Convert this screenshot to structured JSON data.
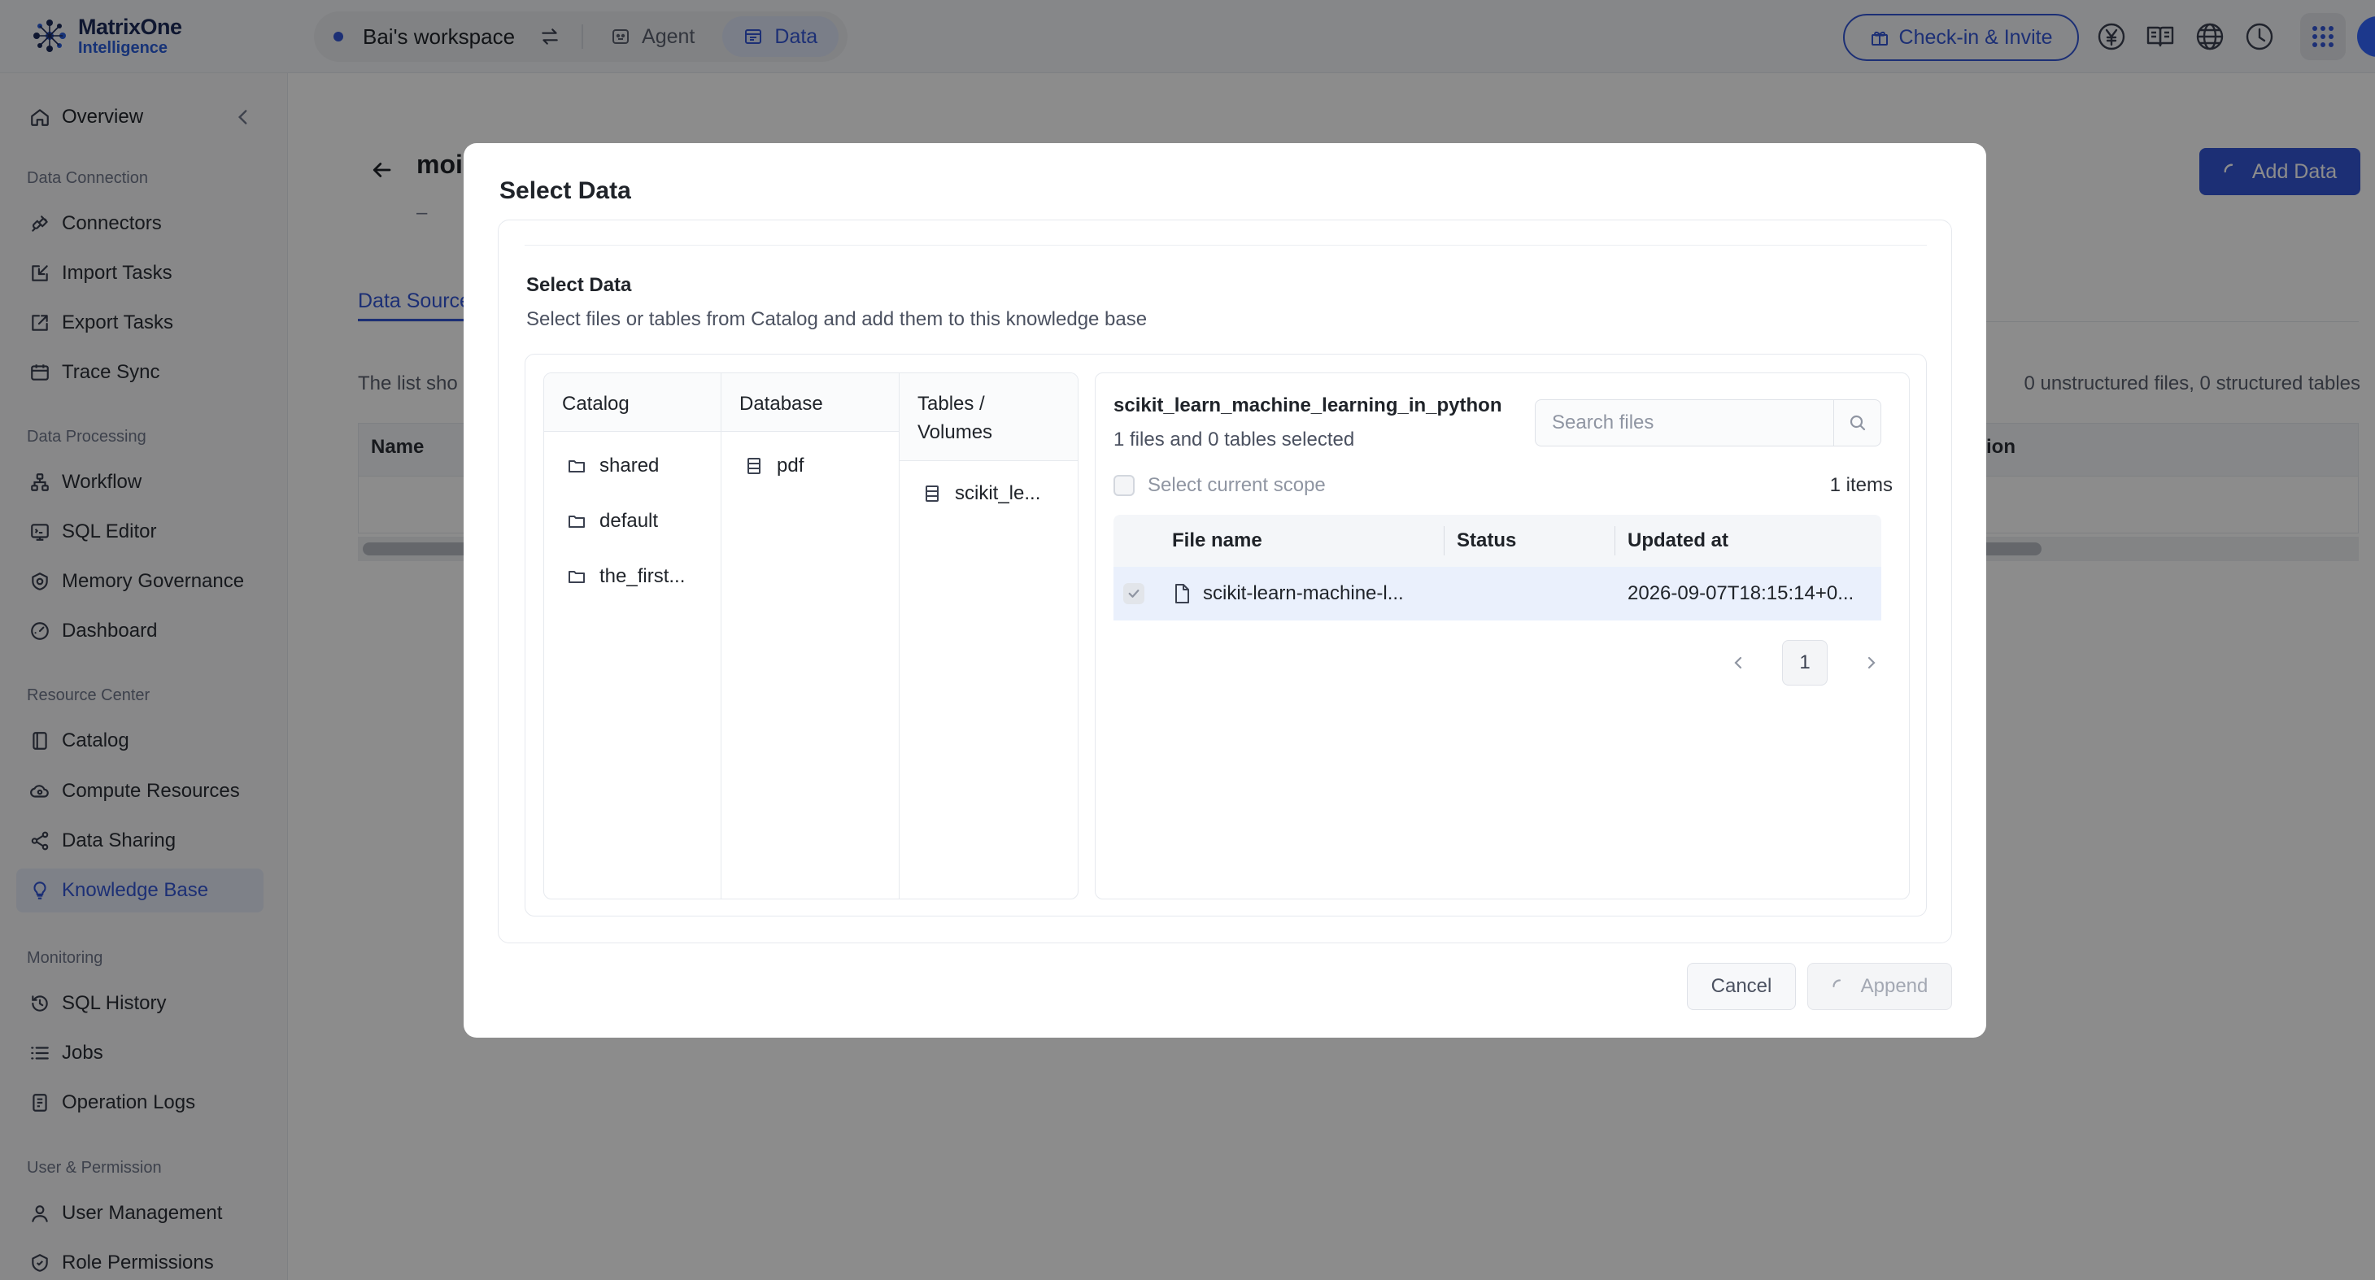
{
  "brand": {
    "name": "MatrixOne",
    "subtitle": "Intelligence"
  },
  "topbar": {
    "workspace": "Bai's workspace",
    "tabs": [
      {
        "label": "Agent"
      },
      {
        "label": "Data",
        "active": true
      }
    ],
    "checkin_label": "Check-in & Invite",
    "icons": [
      "yen-icon",
      "book-icon",
      "globe-icon",
      "clock-icon",
      "apps-grid-icon"
    ],
    "accent_color": "#3457d5"
  },
  "sidebar": {
    "overview": "Overview",
    "groups": [
      {
        "label": "Data Connection",
        "items": [
          "Connectors",
          "Import Tasks",
          "Export Tasks",
          "Trace Sync"
        ]
      },
      {
        "label": "Data Processing",
        "items": [
          "Workflow",
          "SQL Editor",
          "Memory Governance",
          "Dashboard"
        ]
      },
      {
        "label": "Resource Center",
        "items": [
          "Catalog",
          "Compute Resources",
          "Data Sharing",
          "Knowledge Base"
        ]
      },
      {
        "label": "Monitoring",
        "items": [
          "SQL History",
          "Jobs",
          "Operation Logs"
        ]
      },
      {
        "label": "User & Permission",
        "items": [
          "User Management",
          "Role Permissions"
        ]
      }
    ],
    "active_item": "Knowledge Base"
  },
  "main": {
    "title_partial": "moi",
    "dash": "–",
    "tab_partial": "Data Source",
    "list_note_partial": "The list sho",
    "counts": "0 unstructured files, 0 structured tables",
    "table_header_name": "Name",
    "table_header_partial": "tion",
    "add_data_label": "Add Data"
  },
  "modal": {
    "title": "Select Data",
    "section_title": "Select Data",
    "section_subtitle": "Select files or tables from Catalog and add them to this knowledge base",
    "columns": {
      "catalog": {
        "header": "Catalog",
        "items": [
          "shared",
          "default",
          "the_first..."
        ]
      },
      "database": {
        "header": "Database",
        "items": [
          "pdf"
        ]
      },
      "tables": {
        "header_line1": "Tables /",
        "header_line2": "Volumes",
        "items": [
          "scikit_le..."
        ]
      }
    },
    "detail": {
      "title": "scikit_learn_machine_learning_in_python",
      "selected_summary": "1 files and 0 tables selected",
      "search_placeholder": "Search files",
      "select_scope_label": "Select current scope",
      "items_count": "1 items",
      "headers": {
        "file_name": "File name",
        "status": "Status",
        "updated_at": "Updated at"
      },
      "rows": [
        {
          "file_name": "scikit-learn-machine-l...",
          "status": "",
          "updated_at": "2026-09-07T18:15:14+0...",
          "checked": true
        }
      ],
      "page": "1"
    },
    "cancel_label": "Cancel",
    "append_label": "Append"
  }
}
